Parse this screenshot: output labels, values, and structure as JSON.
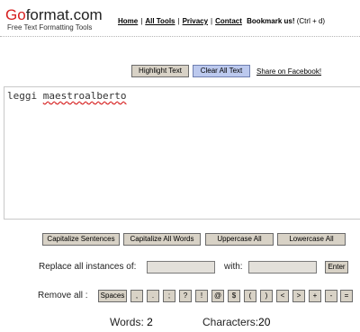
{
  "header": {
    "logo_part1": "Go",
    "logo_part2": "format.com",
    "tagline": "Free Text Formatting Tools",
    "nav": [
      "Home",
      "All Tools",
      "Privacy",
      "Contact"
    ],
    "bookmark_label": "Bookmark us!",
    "bookmark_hint": "(Ctrl + d)"
  },
  "toolbar": {
    "highlight_label": "Highlight Text",
    "clear_label": "Clear All Text",
    "share_label": "Share on Facebook!"
  },
  "editor": {
    "word1": "leggi",
    "word2": "maestroalberto"
  },
  "case_buttons": [
    "Capitalize Sentences",
    "Capitalize All Words",
    "Uppercase All",
    "Lowercase All"
  ],
  "replace": {
    "label": "Replace all instances of:",
    "with_label": "with:",
    "enter_label": "Enter"
  },
  "remove": {
    "label": "Remove all :",
    "items": [
      "Spaces",
      ",",
      ".",
      ";",
      "?",
      "!",
      "@",
      "$",
      "(",
      ")",
      "<",
      ">",
      "+",
      "-",
      "="
    ]
  },
  "stats": {
    "words_label": "Words:",
    "words_value": "2",
    "chars_label": "Characters:",
    "chars_value": "20"
  },
  "colors": {
    "brand_red": "#d61f1f",
    "button_bg": "#d8d2c6",
    "clear_button_bg": "#bcc9ee"
  }
}
